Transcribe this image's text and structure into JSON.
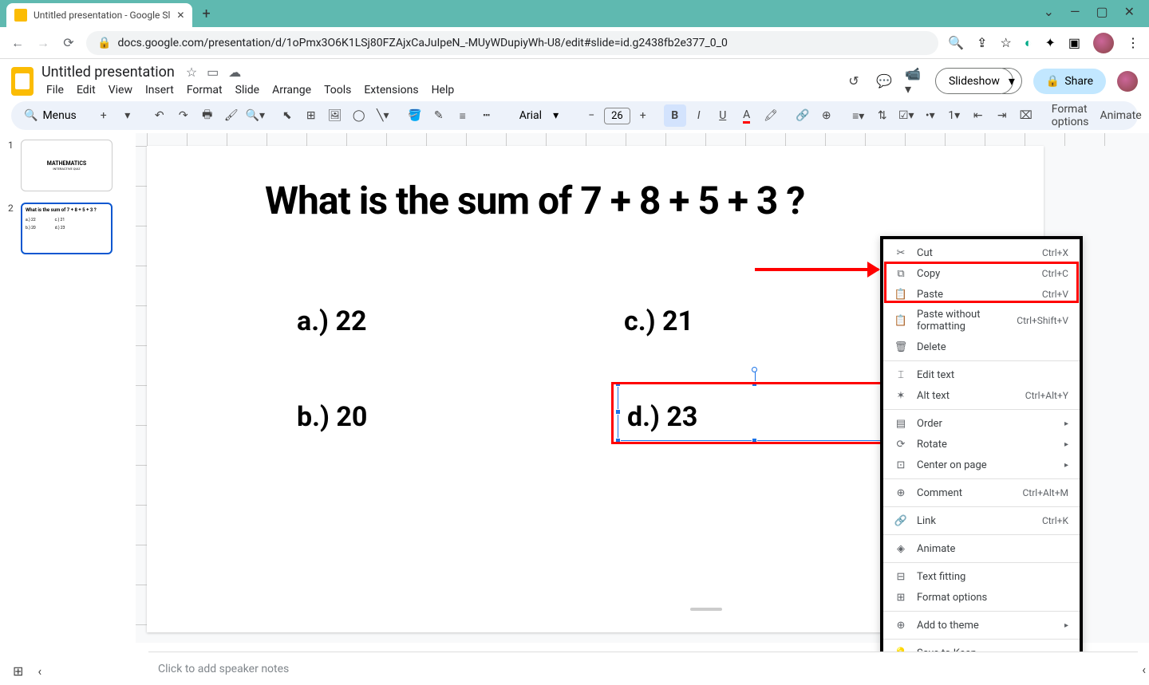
{
  "browser": {
    "tab_title": "Untitled presentation - Google Sl",
    "url": "docs.google.com/presentation/d/1oPmx3O6K1LSj80FZAjxCaJuIpeN_-MUyWDupiyWh-U8/edit#slide=id.g2438fb2e377_0_0"
  },
  "app": {
    "title": "Untitled presentation",
    "menus": [
      "File",
      "Edit",
      "View",
      "Insert",
      "Format",
      "Slide",
      "Arrange",
      "Tools",
      "Extensions",
      "Help"
    ],
    "slideshow": "Slideshow",
    "share": "Share"
  },
  "toolbar": {
    "menus_label": "Menus",
    "font": "Arial",
    "font_size": "26",
    "format_options": "Format options",
    "animate": "Animate"
  },
  "slides": [
    {
      "number": "1",
      "thumb_title": "MATHEMATICS",
      "thumb_sub": "INTERACTIVE QUIZ"
    },
    {
      "number": "2",
      "thumb_title": "What is the sum of 7 + 8 + 5 + 3 ?"
    }
  ],
  "current_slide": {
    "title": "What is the sum of 7 + 8 + 5 + 3 ?",
    "answers": {
      "a": "a.) 22",
      "b": "b.) 20",
      "c": "c.) 21",
      "d": "d.) 23"
    }
  },
  "context_menu": {
    "cut": "Cut",
    "cut_k": "Ctrl+X",
    "copy": "Copy",
    "copy_k": "Ctrl+C",
    "paste": "Paste",
    "paste_k": "Ctrl+V",
    "paste_nf": "Paste without formatting",
    "paste_nf_k": "Ctrl+Shift+V",
    "delete": "Delete",
    "edit_text": "Edit text",
    "alt_text": "Alt text",
    "alt_text_k": "Ctrl+Alt+Y",
    "order": "Order",
    "rotate": "Rotate",
    "center": "Center on page",
    "comment": "Comment",
    "comment_k": "Ctrl+Alt+M",
    "link": "Link",
    "link_k": "Ctrl+K",
    "animate": "Animate",
    "text_fitting": "Text fitting",
    "format_options": "Format options",
    "add_theme": "Add to theme",
    "save_keep": "Save to Keep"
  },
  "notes": {
    "placeholder": "Click to add speaker notes"
  }
}
